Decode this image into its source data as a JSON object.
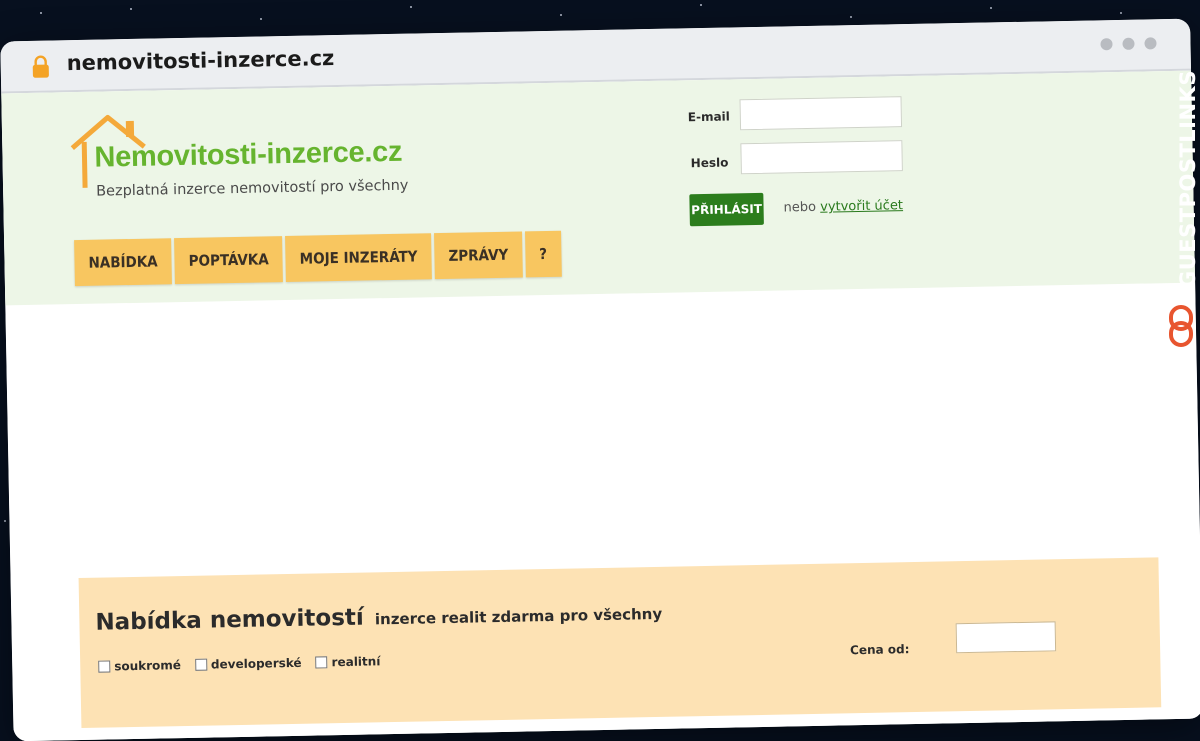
{
  "browser": {
    "url": "nemovitosti-inzerce.cz"
  },
  "logo": {
    "title": "Nemovitosti-inzerce.cz",
    "subtitle": "Bezplatná inzerce nemovitostí pro všechny"
  },
  "nav": {
    "items": [
      {
        "label": "NABÍDKA"
      },
      {
        "label": "POPTÁVKA"
      },
      {
        "label": "MOJE INZERÁTY"
      },
      {
        "label": "ZPRÁVY"
      },
      {
        "label": "?"
      }
    ]
  },
  "login": {
    "email_label": "E-mail",
    "password_label": "Heslo",
    "submit_label": "PŘIHLÁSIT",
    "or_text": "nebo",
    "create_account_link": "vytvořit účet"
  },
  "offers": {
    "title": "Nabídka nemovitostí",
    "subtitle": "inzerce realit zdarma pro všechny",
    "checkboxes": [
      "soukromé",
      "developerské",
      "realitní"
    ],
    "price_from_label": "Cena od:"
  },
  "watermark": {
    "text": "GUESTPOSTLINKS"
  },
  "colors": {
    "header_bg": "#edf6e7",
    "nav_bg": "#f8c660",
    "login_button": "#2c7d1d",
    "logo_green": "#66b42f",
    "logo_orange": "#f4a93a",
    "content_box": "#fde2b4",
    "watermark_accent": "#e8552f"
  }
}
